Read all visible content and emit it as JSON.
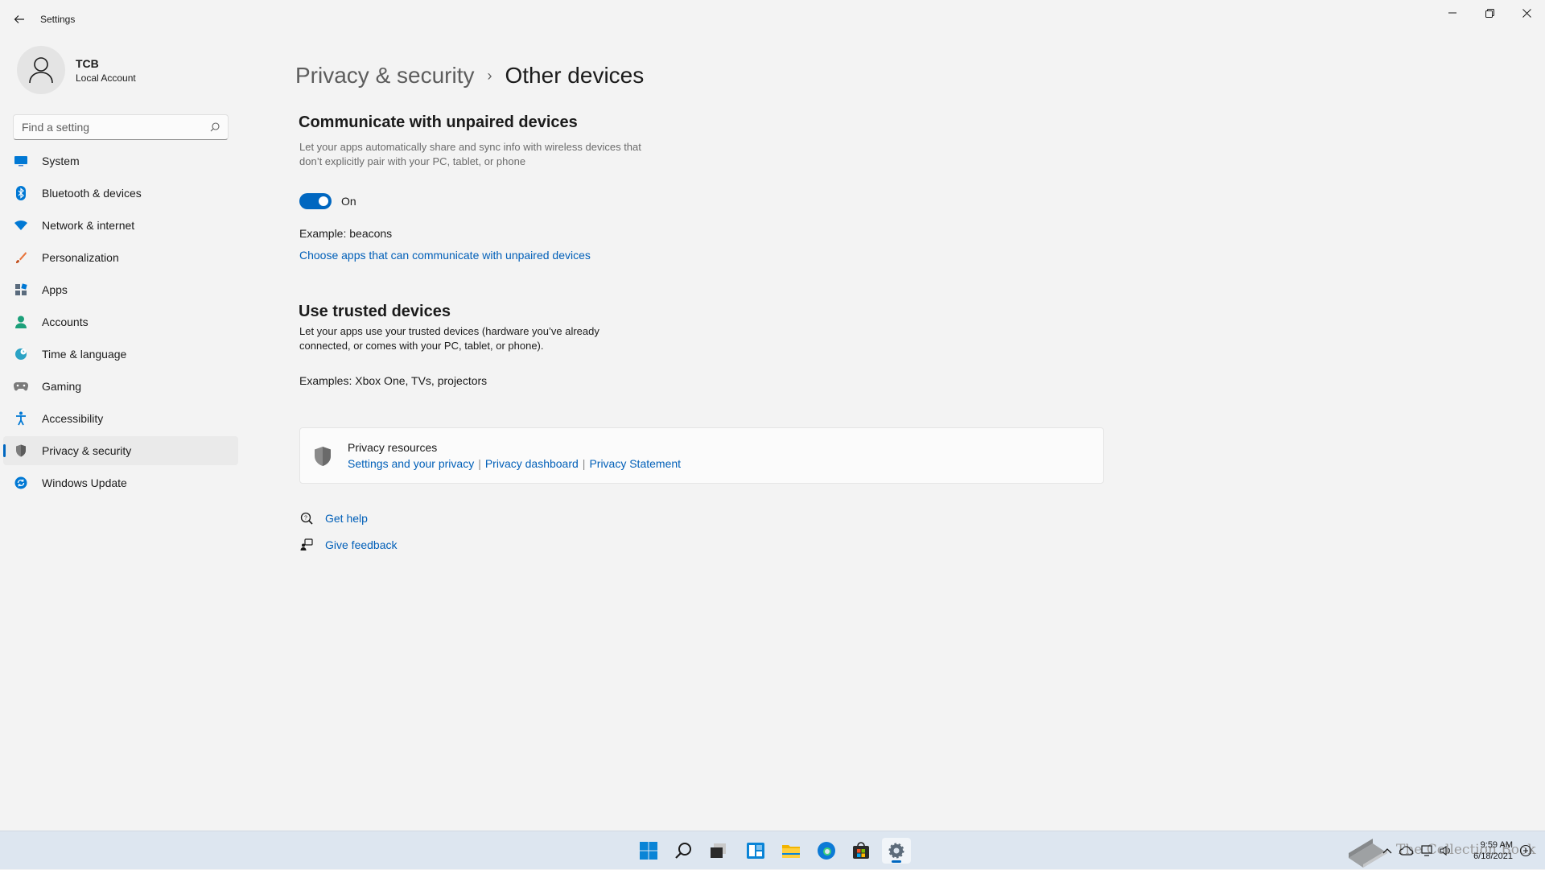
{
  "titlebar": {
    "app_title": "Settings"
  },
  "profile": {
    "name": "TCB",
    "account_type": "Local Account"
  },
  "search": {
    "placeholder": "Find a setting"
  },
  "nav": {
    "items": [
      {
        "label": "System",
        "icon": "system-icon"
      },
      {
        "label": "Bluetooth & devices",
        "icon": "bluetooth-icon"
      },
      {
        "label": "Network & internet",
        "icon": "wifi-icon"
      },
      {
        "label": "Personalization",
        "icon": "brush-icon"
      },
      {
        "label": "Apps",
        "icon": "apps-icon"
      },
      {
        "label": "Accounts",
        "icon": "person-icon"
      },
      {
        "label": "Time & language",
        "icon": "globe-clock-icon"
      },
      {
        "label": "Gaming",
        "icon": "gamepad-icon"
      },
      {
        "label": "Accessibility",
        "icon": "accessibility-icon"
      },
      {
        "label": "Privacy & security",
        "icon": "shield-icon",
        "active": true
      },
      {
        "label": "Windows Update",
        "icon": "update-icon"
      }
    ]
  },
  "breadcrumb": {
    "parent": "Privacy & security",
    "separator": "›",
    "current": "Other devices"
  },
  "unpaired": {
    "title": "Communicate with unpaired devices",
    "description": "Let your apps automatically share and sync info with wireless devices that don’t explicitly pair with your PC, tablet, or phone",
    "toggle_state": "On",
    "toggle_on": true,
    "example": "Example: beacons",
    "link": "Choose apps that can communicate with unpaired devices"
  },
  "trusted": {
    "title": "Use trusted devices",
    "description": "Let your apps use your trusted devices (hardware you’ve already connected, or comes with your PC, tablet, or phone).",
    "example": "Examples: Xbox One, TVs, projectors"
  },
  "privacy_resources": {
    "title": "Privacy resources",
    "links": [
      "Settings and your privacy",
      "Privacy dashboard",
      "Privacy Statement"
    ],
    "separator": "|"
  },
  "help": {
    "get_help": "Get help",
    "give_feedback": "Give feedback"
  },
  "taskbar": {
    "apps": [
      "start-icon",
      "search-icon",
      "task-view-icon",
      "widgets-icon",
      "file-explorer-icon",
      "edge-icon",
      "store-icon",
      "settings-icon"
    ],
    "active_app": "settings-icon",
    "time": "9:59 AM",
    "date": "6/18/2021",
    "watermark": "The Collection Book"
  },
  "colors": {
    "accent": "#0067c0",
    "link": "#005fb8",
    "background": "#f3f3f3",
    "taskbar": "#dde6f0"
  }
}
